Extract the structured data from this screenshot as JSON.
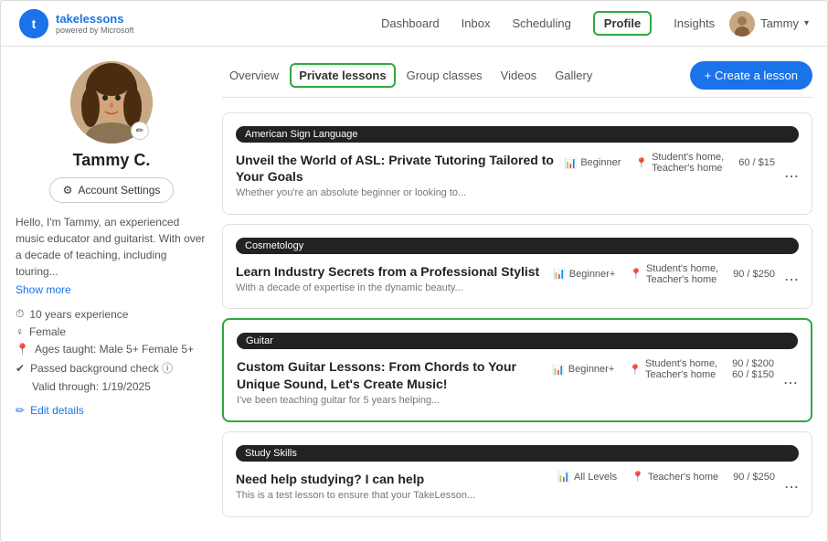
{
  "header": {
    "logo_initial": "T",
    "logo_name": "takelessons",
    "logo_sub": "powered by Microsoft",
    "nav_items": [
      {
        "label": "Dashboard",
        "active": false
      },
      {
        "label": "Inbox",
        "active": false
      },
      {
        "label": "Scheduling",
        "active": false
      },
      {
        "label": "Profile",
        "active": true
      },
      {
        "label": "Insights",
        "active": false
      }
    ],
    "user_name": "Tammy",
    "user_chevron": "▾"
  },
  "tabs": {
    "items": [
      {
        "label": "Overview",
        "active": false
      },
      {
        "label": "Private lessons",
        "active": true
      },
      {
        "label": "Group classes",
        "active": false
      },
      {
        "label": "Videos",
        "active": false
      },
      {
        "label": "Gallery",
        "active": false
      }
    ],
    "create_btn": "+ Create a lesson"
  },
  "sidebar": {
    "name": "Tammy C.",
    "account_settings": "Account Settings",
    "bio": "Hello, I'm Tammy, an experienced music educator and guitarist. With over a decade of teaching, including touring...",
    "show_more": "Show more",
    "meta": [
      {
        "icon": "⏱",
        "text": "10 years experience"
      },
      {
        "icon": "♀",
        "text": "Female"
      },
      {
        "icon": "📍",
        "text": "Ages taught: Male 5+ Female 5+"
      },
      {
        "icon": "✓",
        "text": "Passed background check ⓘ"
      },
      {
        "icon": "",
        "text": "Valid through: 1/19/2025"
      }
    ],
    "edit_details": "Edit details"
  },
  "lessons": [
    {
      "tag": "American Sign Language",
      "title": "Unveil the World of ASL: Private Tutoring Tailored to Your Goals",
      "desc": "Whether you're an absolute beginner or looking to...",
      "level": "Beginner",
      "location": "Student's home,\nTeacher's home",
      "price": "60 / $15",
      "highlighted": false
    },
    {
      "tag": "Cosmetology",
      "title": "Learn Industry Secrets from a Professional Stylist",
      "desc": "With a decade of expertise in the dynamic beauty...",
      "level": "Beginner+",
      "location": "Student's home,\nTeacher's home",
      "price": "90 / $250",
      "highlighted": false
    },
    {
      "tag": "Guitar",
      "title": "Custom Guitar Lessons: From Chords to Your Unique Sound, Let's Create Music!",
      "desc": "I've been teaching guitar for 5 years helping...",
      "level": "Beginner+",
      "location": "Student's home,\nTeacher's home",
      "price1": "90 / $200",
      "price2": "60 / $150",
      "highlighted": true
    },
    {
      "tag": "Study Skills",
      "title": "Need help studying? I can help",
      "desc": "This is a test lesson to ensure that your TakeLesson...",
      "level": "All Levels",
      "location": "Teacher's home",
      "price": "90 / $250",
      "highlighted": false
    }
  ]
}
